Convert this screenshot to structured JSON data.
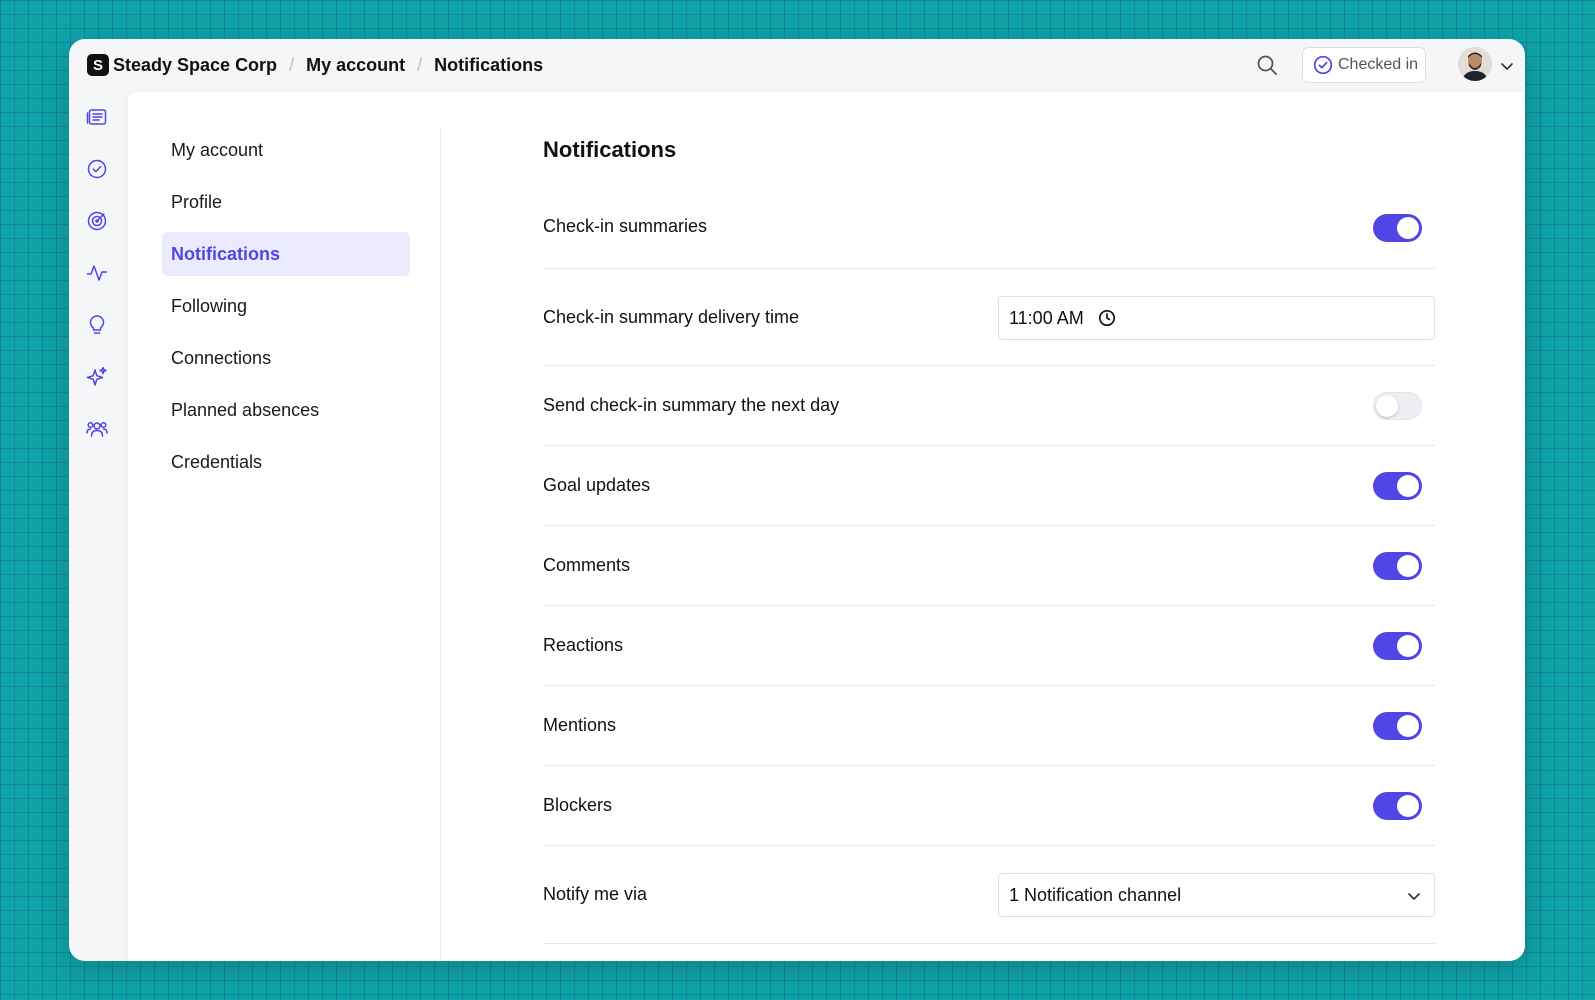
{
  "header": {
    "logo_letter": "S",
    "breadcrumbs": [
      "Steady Space Corp",
      "My account",
      "Notifications"
    ],
    "separator": "/",
    "checked_in_label": "Checked in"
  },
  "sidebar_nav": {
    "items": [
      {
        "label": "My account"
      },
      {
        "label": "Profile"
      },
      {
        "label": "Notifications",
        "active": true
      },
      {
        "label": "Following"
      },
      {
        "label": "Connections"
      },
      {
        "label": "Planned absences"
      },
      {
        "label": "Credentials"
      }
    ]
  },
  "content": {
    "title": "Notifications",
    "settings": [
      {
        "label": "Check-in summaries",
        "type": "toggle",
        "on": true
      },
      {
        "label": "Check-in summary delivery time",
        "type": "time",
        "value": "11:00 AM"
      },
      {
        "label": "Send check-in summary the next day",
        "type": "toggle",
        "on": false
      },
      {
        "label": "Goal updates",
        "type": "toggle",
        "on": true
      },
      {
        "label": "Comments",
        "type": "toggle",
        "on": true
      },
      {
        "label": "Reactions",
        "type": "toggle",
        "on": true
      },
      {
        "label": "Mentions",
        "type": "toggle",
        "on": true
      },
      {
        "label": "Blockers",
        "type": "toggle",
        "on": true
      },
      {
        "label": "Notify me via",
        "type": "select",
        "value": "1 Notification channel"
      }
    ]
  },
  "colors": {
    "accent": "#4f46e5",
    "active_bg": "#ebeafe",
    "background": "#0fa3a8"
  }
}
